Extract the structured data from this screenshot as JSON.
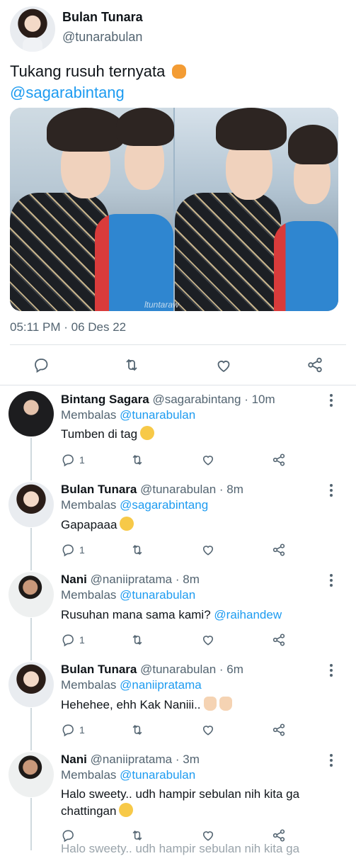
{
  "main_tweet": {
    "author_name": "Bulan Tunara",
    "author_handle": "@tunarabulan",
    "text": "Tukang rusuh ternyata",
    "emoji": "tiger-face",
    "mention": "@sagarabintang",
    "photo_watermark": "ltuntaraw",
    "timestamp": "05:11 PM · 06 Des 22",
    "actions": [
      "reply-icon",
      "retweet-icon",
      "like-icon",
      "share-icon"
    ]
  },
  "replies": [
    {
      "name": "Bintang Sagara",
      "handle": "@sagarabintang",
      "time": "· 10m",
      "replying_label": "Membalas",
      "replying_to": "@tunarabulan",
      "text": "Tumben di tag",
      "emoji": "thinking-face",
      "reply_count": "1"
    },
    {
      "name": "Bulan Tunara",
      "handle": "@tunarabulan",
      "time": "· 8m",
      "replying_label": "Membalas",
      "replying_to": "@sagarabintang",
      "text": "Gapapaaa",
      "emoji": "relieved-face",
      "reply_count": "1"
    },
    {
      "name": "Nani",
      "handle": "@naniipratama",
      "time": "· 8m",
      "replying_label": "Membalas",
      "replying_to": "@tunarabulan",
      "text": "Rusuhan mana sama kami?",
      "mention": "@raihandew",
      "reply_count": "1"
    },
    {
      "name": "Bulan Tunara",
      "handle": "@tunarabulan",
      "time": "· 6m",
      "replying_label": "Membalas",
      "replying_to": "@naniipratama",
      "text": "Hehehee, ehh Kak Naniii..",
      "emoji": "raised-hands",
      "reply_count": "1"
    },
    {
      "name": "Nani",
      "handle": "@naniipratama",
      "time": "· 3m",
      "replying_label": "Membalas",
      "replying_to": "@tunarabulan",
      "text_line1": "Halo sweety.. udh hampir sebulan nih kita ga",
      "text_line2": "chattingan",
      "emoji": "pensive-face",
      "reply_count": ""
    }
  ],
  "clipped_bottom_text": "Halo sweety.. udh hampir sebulan nih kita ga",
  "colors": {
    "link": "#1d9bf0",
    "secondary_text": "#536471",
    "divider": "#dfe3e7"
  }
}
